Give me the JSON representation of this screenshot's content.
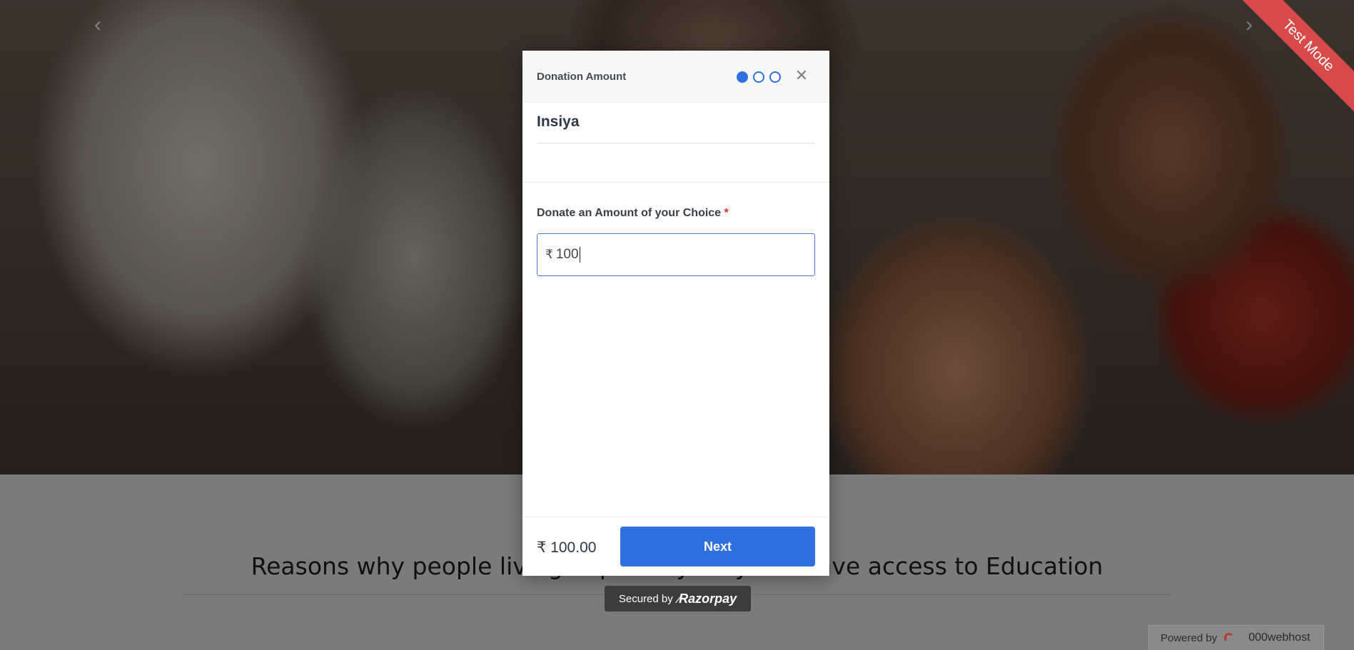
{
  "modal": {
    "title": "Donation Amount",
    "steps": [
      "active",
      "inactive",
      "inactive"
    ],
    "close_icon": "close-icon",
    "org_name": "Insiya",
    "field_label": "Donate an Amount of your Choice",
    "required_mark": "*",
    "currency_symbol": "₹",
    "amount_value": "100",
    "total_label": "₹ 100.00",
    "next_label": "Next"
  },
  "secured_badge": {
    "text": "Secured by",
    "brand": "Razorpay"
  },
  "ribbon": {
    "text": "Test Mode",
    "color": "#d84a4a"
  },
  "page": {
    "section_title": "Reasons why people living in poverty may not have access to Education"
  },
  "powered_badge": {
    "text": "Powered by",
    "brand": "000webhost"
  },
  "colors": {
    "accent": "#2f6fe0",
    "required": "#e0302e"
  }
}
